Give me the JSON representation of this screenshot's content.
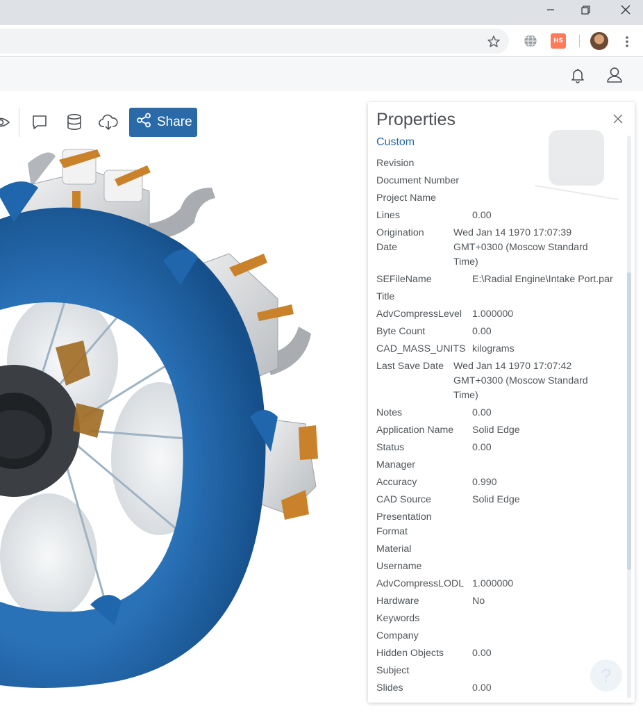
{
  "colors": {
    "accent": "#2a6aa8",
    "engine_cowling": "#1f66ad",
    "panel_text": "#505559"
  },
  "browser": {
    "icons": [
      "minimize-icon",
      "restore-icon",
      "close-icon",
      "star-icon",
      "globe-icon",
      "hubspot-icon",
      "avatar",
      "more-vert-icon"
    ],
    "hubspot_glyph": "HS"
  },
  "app_header": {
    "icons": [
      "bell-icon",
      "user-icon"
    ]
  },
  "toolbar": {
    "icons": [
      "eye-icon",
      "comment-icon",
      "database-icon",
      "cloud-download-icon"
    ],
    "share_label": "Share"
  },
  "panel": {
    "title": "Properties",
    "tab": "Custom",
    "help_glyph": "?",
    "rows": [
      {
        "key": "Revision",
        "value": ""
      },
      {
        "key": "Document Number",
        "value": ""
      },
      {
        "key": "Project Name",
        "value": ""
      },
      {
        "key": "Lines",
        "value": "0.00"
      },
      {
        "key": "Origination Date",
        "value": "Wed Jan 14 1970 17:07:39 GMT+0300 (Moscow Standard Time)"
      },
      {
        "key": "SEFileName",
        "value": "E:\\Radial Engine\\Intake Port.par"
      },
      {
        "key": "Title",
        "value": ""
      },
      {
        "key": "AdvCompressLevel",
        "value": "1.000000"
      },
      {
        "key": "Byte Count",
        "value": "0.00"
      },
      {
        "key": "CAD_MASS_UNITS",
        "value": "kilograms"
      },
      {
        "key": "Last Save Date",
        "value": "Wed Jan 14 1970 17:07:42 GMT+0300 (Moscow Standard Time)"
      },
      {
        "key": "Notes",
        "value": "0.00"
      },
      {
        "key": "Application Name",
        "value": "Solid Edge"
      },
      {
        "key": "Status",
        "value": "0.00"
      },
      {
        "key": "Manager",
        "value": ""
      },
      {
        "key": "Accuracy",
        "value": "0.990"
      },
      {
        "key": "CAD Source",
        "value": "Solid Edge"
      },
      {
        "key": "Presentation Format",
        "value": ""
      },
      {
        "key": "Material",
        "value": ""
      },
      {
        "key": "Username",
        "value": ""
      },
      {
        "key": "AdvCompressLODL",
        "value": "1.000000"
      },
      {
        "key": "Hardware",
        "value": "No"
      },
      {
        "key": "Keywords",
        "value": ""
      },
      {
        "key": "Company",
        "value": ""
      },
      {
        "key": "Hidden Objects",
        "value": "0.00"
      },
      {
        "key": "Subject",
        "value": ""
      },
      {
        "key": "Slides",
        "value": "0.00"
      }
    ]
  }
}
